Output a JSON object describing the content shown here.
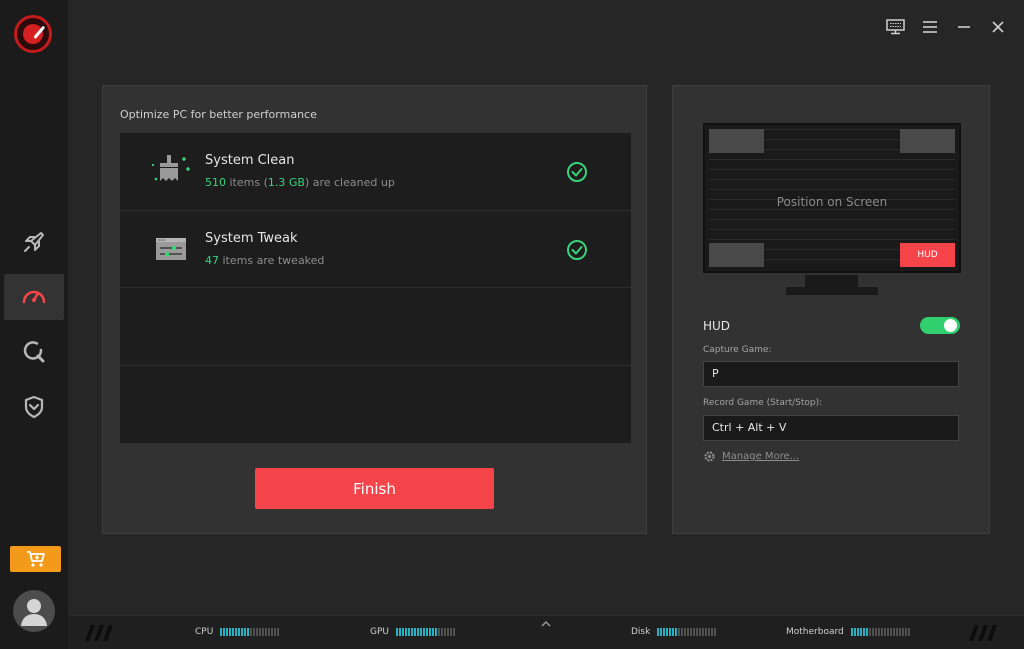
{
  "sidebar": {
    "logo": "speedometer-logo-icon",
    "items": [
      {
        "name": "boost",
        "icon": "rocket-icon",
        "active": false
      },
      {
        "name": "optimize",
        "icon": "speedometer-icon",
        "active": true
      },
      {
        "name": "scan",
        "icon": "search-icon",
        "active": false
      },
      {
        "name": "security",
        "icon": "shield-icon",
        "active": false
      }
    ],
    "cart_icon": "cart-icon",
    "avatar_icon": "user-avatar-icon"
  },
  "titlebar": {
    "icons": [
      "display-icon",
      "menu-icon",
      "minimize-icon",
      "close-icon"
    ]
  },
  "optimize": {
    "title": "Optimize PC for better performance",
    "items": [
      {
        "title": "System Clean",
        "count": "510",
        "sub_mid": " items (",
        "size": "1.3 GB",
        "sub_end": ") are cleaned up",
        "status": "done"
      },
      {
        "title": "System Tweak",
        "count": "47",
        "sub_end": " items are tweaked",
        "status": "done"
      }
    ],
    "finish_label": "Finish"
  },
  "hud_panel": {
    "preview_label": "Position on Screen",
    "hud_badge": "HUD",
    "hud_label": "HUD",
    "hud_enabled": true,
    "capture_label": "Capture Game:",
    "capture_value": "P",
    "record_label": "Record Game (Start/Stop):",
    "record_value": "Ctrl + Alt + V",
    "manage_label": "Manage More..."
  },
  "statusbar": {
    "monitors": [
      {
        "label": "CPU",
        "level": 0.5
      },
      {
        "label": "GPU",
        "level": 0.7
      },
      {
        "label": "Disk",
        "level": 0.35
      },
      {
        "label": "Motherboard",
        "level": 0.3
      }
    ]
  },
  "colors": {
    "accent_red": "#f6444b",
    "green": "#31cf6e",
    "cyan": "#29b2c4",
    "orange": "#f39a1a"
  }
}
